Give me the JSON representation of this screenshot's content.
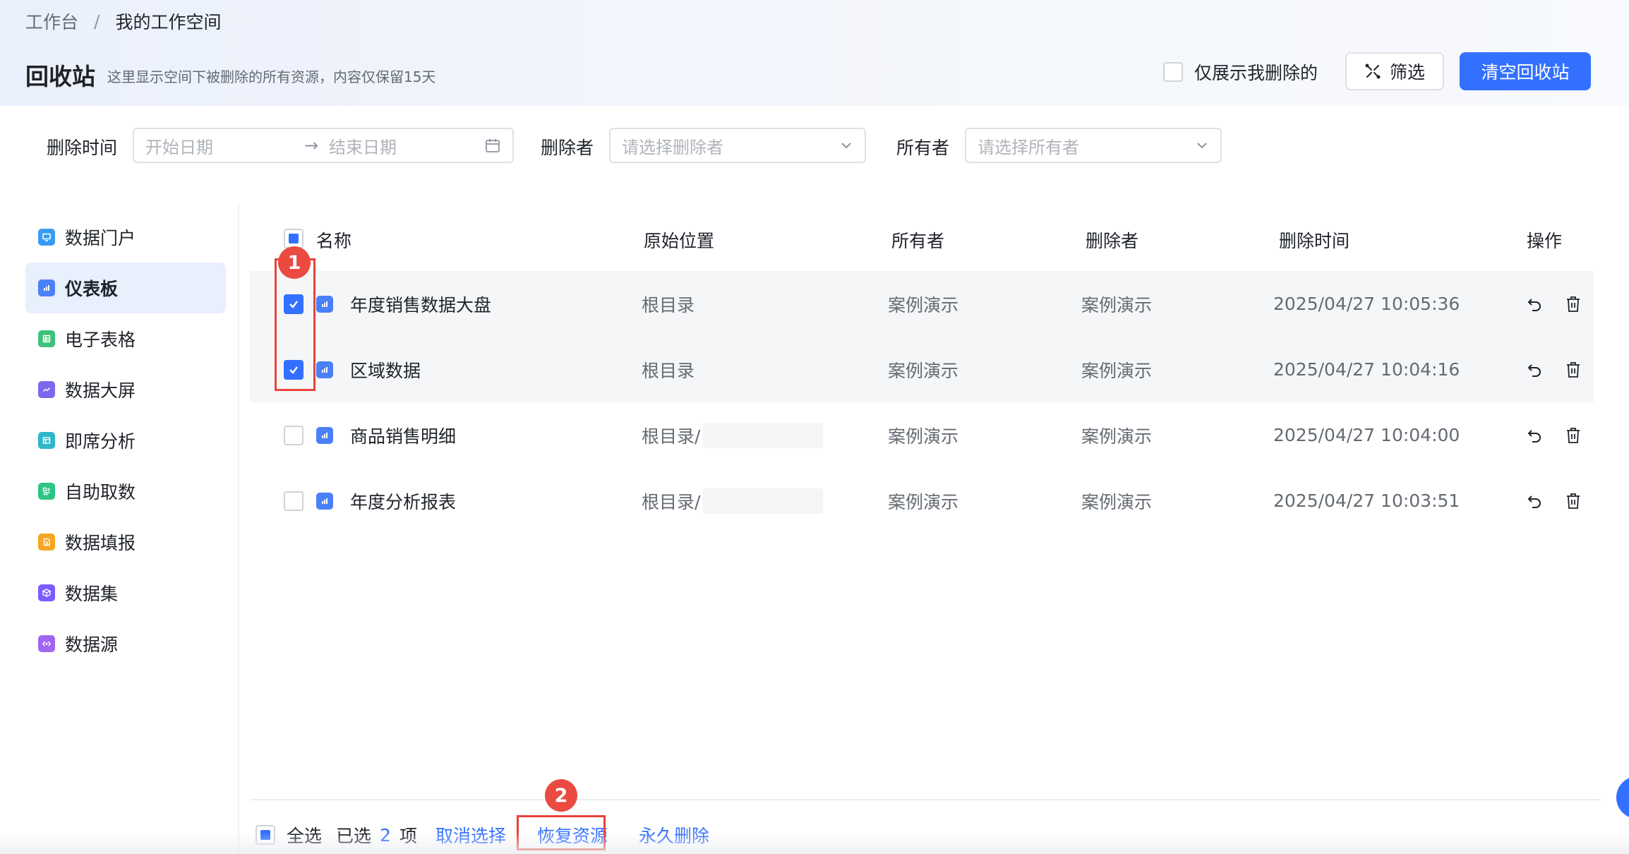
{
  "breadcrumb": {
    "root": "工作台",
    "separator": "/",
    "current": "我的工作空间"
  },
  "header": {
    "title": "回收站",
    "subtitle": "这里显示空间下被删除的所有资源，内容仅保留15天",
    "only_mine_label": "仅展示我删除的",
    "filter_button": "筛选",
    "clear_button": "清空回收站"
  },
  "filters": {
    "delete_time_label": "删除时间",
    "start_placeholder": "开始日期",
    "range_arrow": "→",
    "end_placeholder": "结束日期",
    "deleter_label": "删除者",
    "deleter_placeholder": "请选择删除者",
    "owner_label": "所有者",
    "owner_placeholder": "请选择所有者"
  },
  "sidebar": {
    "items": [
      {
        "label": "数据门户",
        "icon": "portal-icon",
        "color": "#3a9bf5",
        "active": false
      },
      {
        "label": "仪表板",
        "icon": "dashboard-icon",
        "color": "#4a80f8",
        "active": true
      },
      {
        "label": "电子表格",
        "icon": "spreadsheet-icon",
        "color": "#3ec27a",
        "active": false
      },
      {
        "label": "数据大屏",
        "icon": "screen-icon",
        "color": "#7b68ee",
        "active": false
      },
      {
        "label": "即席分析",
        "icon": "adhoc-icon",
        "color": "#2fb6c9",
        "active": false
      },
      {
        "label": "自助取数",
        "icon": "selfservice-icon",
        "color": "#2ec486",
        "active": false
      },
      {
        "label": "数据填报",
        "icon": "form-icon",
        "color": "#f5a623",
        "active": false
      },
      {
        "label": "数据集",
        "icon": "dataset-icon",
        "color": "#7c5cff",
        "active": false
      },
      {
        "label": "数据源",
        "icon": "datasource-icon",
        "color": "#a066f0",
        "active": false
      }
    ]
  },
  "table": {
    "columns": [
      "名称",
      "原始位置",
      "所有者",
      "删除者",
      "删除时间",
      "操作"
    ],
    "rows": [
      {
        "name": "年度销售数据大盘",
        "location": "根目录",
        "owner": "案例演示",
        "deleter": "案例演示",
        "time": "2025/04/27 10:05:36",
        "checked": true
      },
      {
        "name": "区域数据",
        "location": "根目录",
        "owner": "案例演示",
        "deleter": "案例演示",
        "time": "2025/04/27 10:04:16",
        "checked": true
      },
      {
        "name": "商品销售明细",
        "location": "根目录/",
        "owner": "案例演示",
        "deleter": "案例演示",
        "time": "2025/04/27 10:04:00",
        "checked": false
      },
      {
        "name": "年度分析报表",
        "location": "根目录/",
        "owner": "案例演示",
        "deleter": "案例演示",
        "time": "2025/04/27 10:03:51",
        "checked": false
      }
    ]
  },
  "footer": {
    "select_all": "全选",
    "selected_prefix": "已选",
    "selected_count": "2",
    "selected_suffix": "项",
    "cancel_selection": "取消选择",
    "restore": "恢复资源",
    "delete_forever": "永久删除"
  },
  "annotations": {
    "badge1": "1",
    "badge2": "2"
  },
  "colors": {
    "primary": "#3370ff",
    "annotation": "#e9423a"
  }
}
